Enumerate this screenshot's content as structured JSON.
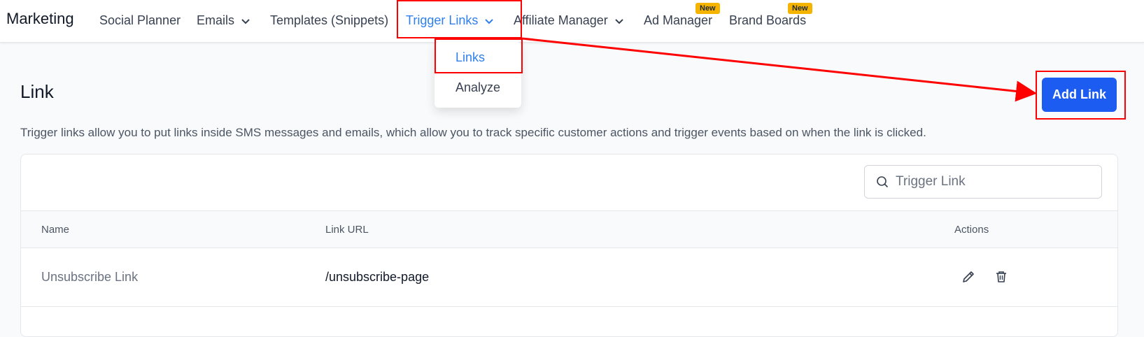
{
  "header": {
    "brand": "Marketing",
    "nav": [
      {
        "label": "Social Planner"
      },
      {
        "label": "Emails"
      },
      {
        "label": "Templates (Snippets)"
      },
      {
        "label": "Trigger Links"
      },
      {
        "label": "Affiliate Manager"
      },
      {
        "label": "Ad Manager",
        "badge": "New"
      },
      {
        "label": "Brand Boards",
        "badge": "New"
      }
    ]
  },
  "dropdown": {
    "items": [
      {
        "label": "Links"
      },
      {
        "label": "Analyze"
      }
    ]
  },
  "page": {
    "title": "Link",
    "description": "Trigger links allow you to put links inside SMS messages and emails, which allow you to track specific customer actions and trigger events based on when the link is clicked.",
    "add_button": "Add Link"
  },
  "search": {
    "placeholder": "Trigger Link",
    "value": ""
  },
  "table": {
    "columns": [
      "Name",
      "Link URL",
      "Actions"
    ],
    "rows": [
      {
        "name": "Unsubscribe Link",
        "url": "/unsubscribe-page"
      }
    ]
  },
  "colors": {
    "accent": "#2f80ed",
    "button": "#1d5cf0",
    "badge": "#f5b400",
    "annotation": "#ff0000"
  },
  "icons": [
    "chevron-down-icon",
    "search-icon",
    "edit-icon",
    "trash-icon",
    "arrow-icon"
  ]
}
